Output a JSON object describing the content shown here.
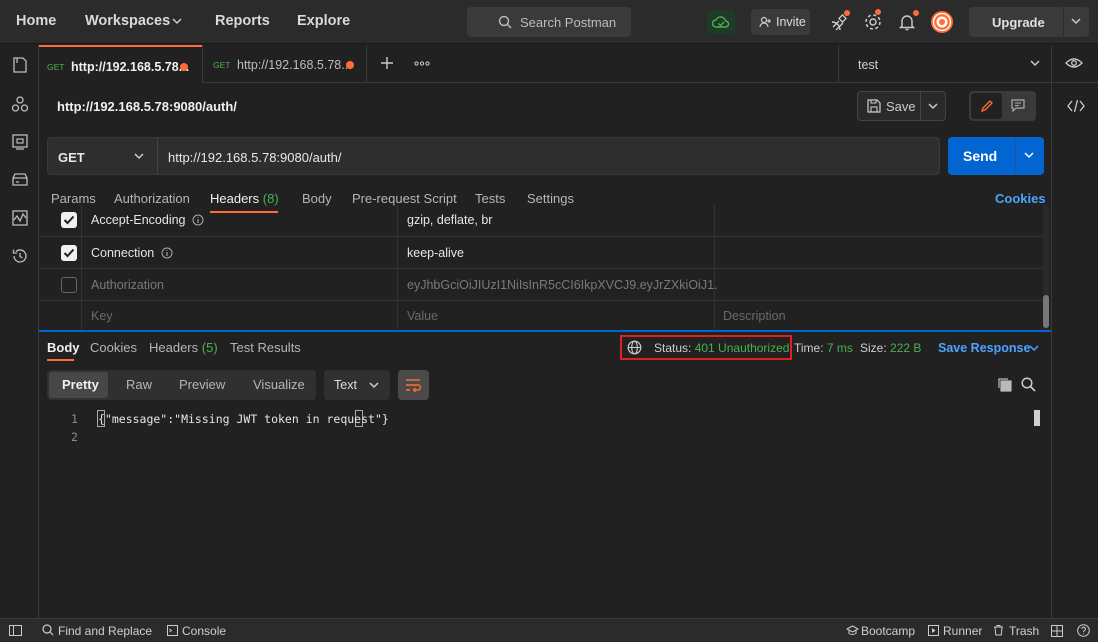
{
  "topbar": {
    "nav": [
      "Home",
      "Workspaces",
      "Reports",
      "Explore"
    ],
    "search_placeholder": "Search Postman",
    "invite_label": "Invite",
    "upgrade_label": "Upgrade"
  },
  "tabs": [
    {
      "method": "GET",
      "url": "http://192.168.5.78..."
    },
    {
      "method": "GET",
      "url": "http://192.168.5.78..."
    }
  ],
  "environment": "test",
  "request": {
    "title": "http://192.168.5.78:9080/auth/",
    "save_label": "Save",
    "method": "GET",
    "url": "http://192.168.5.78:9080/auth/",
    "send_label": "Send",
    "tabs": [
      "Params",
      "Authorization",
      "Headers",
      "Body",
      "Pre-request Script",
      "Tests",
      "Settings"
    ],
    "headers_label": "Headers",
    "headers_count": "(8)",
    "cookies_label": "Cookies"
  },
  "headers_rows": [
    {
      "key": "Accept-Encoding",
      "value": "gzip, deflate, br",
      "checked": true
    },
    {
      "key": "Connection",
      "value": "keep-alive",
      "checked": true
    },
    {
      "key": "Authorization",
      "value": "eyJhbGciOiJIUzI1NiIsInR5cCI6IkpXVCJ9.eyJrZXkiOiJ1...",
      "checked": false
    }
  ],
  "headers_placeholder": {
    "key": "Key",
    "value": "Value",
    "description": "Description"
  },
  "response": {
    "tabs": [
      "Body",
      "Cookies",
      "Headers",
      "Test Results"
    ],
    "headers_count": "(5)",
    "status_label": "Status:",
    "status_value": "401 Unauthorized",
    "time_label": "Time:",
    "time_value": "7 ms",
    "size_label": "Size:",
    "size_value": "222 B",
    "save_response": "Save Response",
    "formats": [
      "Pretty",
      "Raw",
      "Preview",
      "Visualize"
    ],
    "text_select": "Text",
    "lines": [
      {
        "num": "1",
        "code": "{\"message\":\"Missing JWT token in request\"}"
      },
      {
        "num": "2",
        "code": ""
      }
    ]
  },
  "bottombar": {
    "find_replace": "Find and Replace",
    "console": "Console",
    "bootcamp": "Bootcamp",
    "runner": "Runner",
    "trash": "Trash"
  },
  "colors": {
    "accent": "#ff6c37",
    "send": "#0265d2",
    "link": "#4da3ff",
    "status_ok": "#4caf50"
  }
}
